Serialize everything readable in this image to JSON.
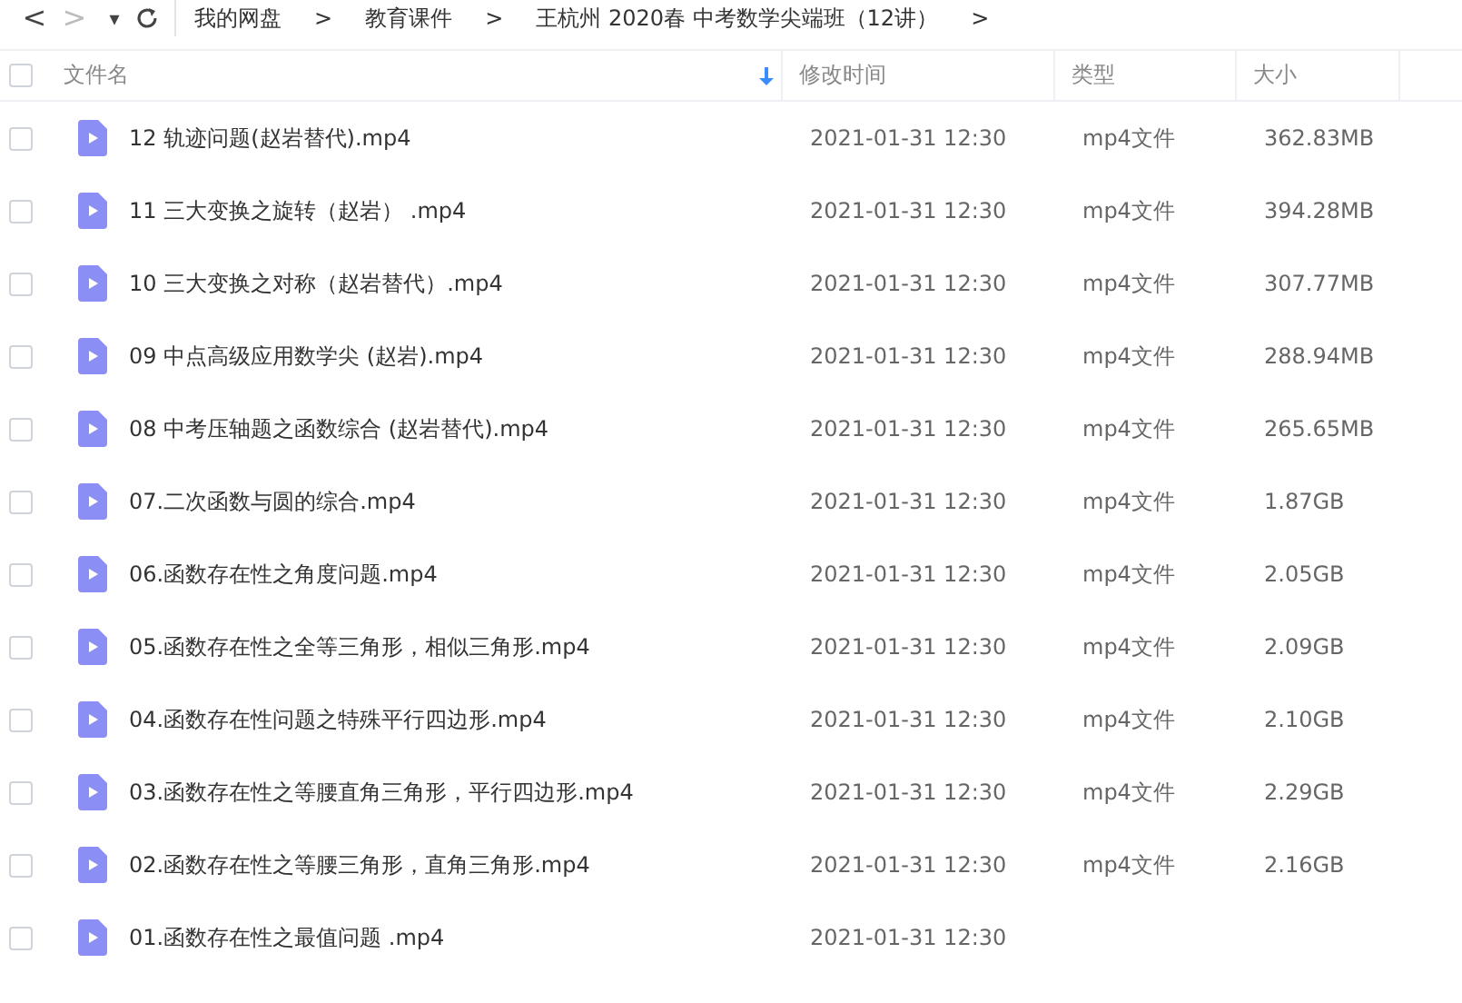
{
  "nav": {
    "back": "<",
    "forward": ">",
    "dropdown": "▾",
    "breadcrumb": [
      {
        "label": "我的网盘"
      },
      {
        "label": "教育课件"
      },
      {
        "label": "王杭州 2020春 中考数学尖端班（12讲）"
      }
    ],
    "separator": ">"
  },
  "table": {
    "select_all_checked": false,
    "columns": [
      {
        "label": "文件名",
        "sorted": true
      },
      {
        "label": "修改时间",
        "sorted": false
      },
      {
        "label": "类型",
        "sorted": false
      },
      {
        "label": "大小",
        "sorted": false
      }
    ],
    "rows": [
      {
        "checked": false,
        "name": "12 轨迹问题(赵岩替代).mp4",
        "modified": "2021-01-31 12:30",
        "type": "mp4文件",
        "size": "362.83MB"
      },
      {
        "checked": false,
        "name": "11 三大变换之旋转（赵岩） .mp4",
        "modified": "2021-01-31 12:30",
        "type": "mp4文件",
        "size": "394.28MB"
      },
      {
        "checked": false,
        "name": "10 三大变换之对称（赵岩替代）.mp4",
        "modified": "2021-01-31 12:30",
        "type": "mp4文件",
        "size": "307.77MB"
      },
      {
        "checked": false,
        "name": "09 中点高级应用数学尖 (赵岩).mp4",
        "modified": "2021-01-31 12:30",
        "type": "mp4文件",
        "size": "288.94MB"
      },
      {
        "checked": false,
        "name": "08 中考压轴题之函数综合 (赵岩替代).mp4",
        "modified": "2021-01-31 12:30",
        "type": "mp4文件",
        "size": "265.65MB"
      },
      {
        "checked": false,
        "name": "07.二次函数与圆的综合.mp4",
        "modified": "2021-01-31 12:30",
        "type": "mp4文件",
        "size": "1.87GB"
      },
      {
        "checked": false,
        "name": "06.函数存在性之角度问题.mp4",
        "modified": "2021-01-31 12:30",
        "type": "mp4文件",
        "size": "2.05GB"
      },
      {
        "checked": false,
        "name": "05.函数存在性之全等三角形，相似三角形.mp4",
        "modified": "2021-01-31 12:30",
        "type": "mp4文件",
        "size": "2.09GB"
      },
      {
        "checked": false,
        "name": "04.函数存在性问题之特殊平行四边形.mp4",
        "modified": "2021-01-31 12:30",
        "type": "mp4文件",
        "size": "2.10GB"
      },
      {
        "checked": false,
        "name": "03.函数存在性之等腰直角三角形，平行四边形.mp4",
        "modified": "2021-01-31 12:30",
        "type": "mp4文件",
        "size": "2.29GB"
      },
      {
        "checked": false,
        "name": "02.函数存在性之等腰三角形，直角三角形.mp4",
        "modified": "2021-01-31 12:30",
        "type": "mp4文件",
        "size": "2.16GB"
      },
      {
        "checked": false,
        "name": "01.函数存在性之最值问题 .mp4",
        "modified": "2021-01-31 12:30"
      }
    ]
  }
}
